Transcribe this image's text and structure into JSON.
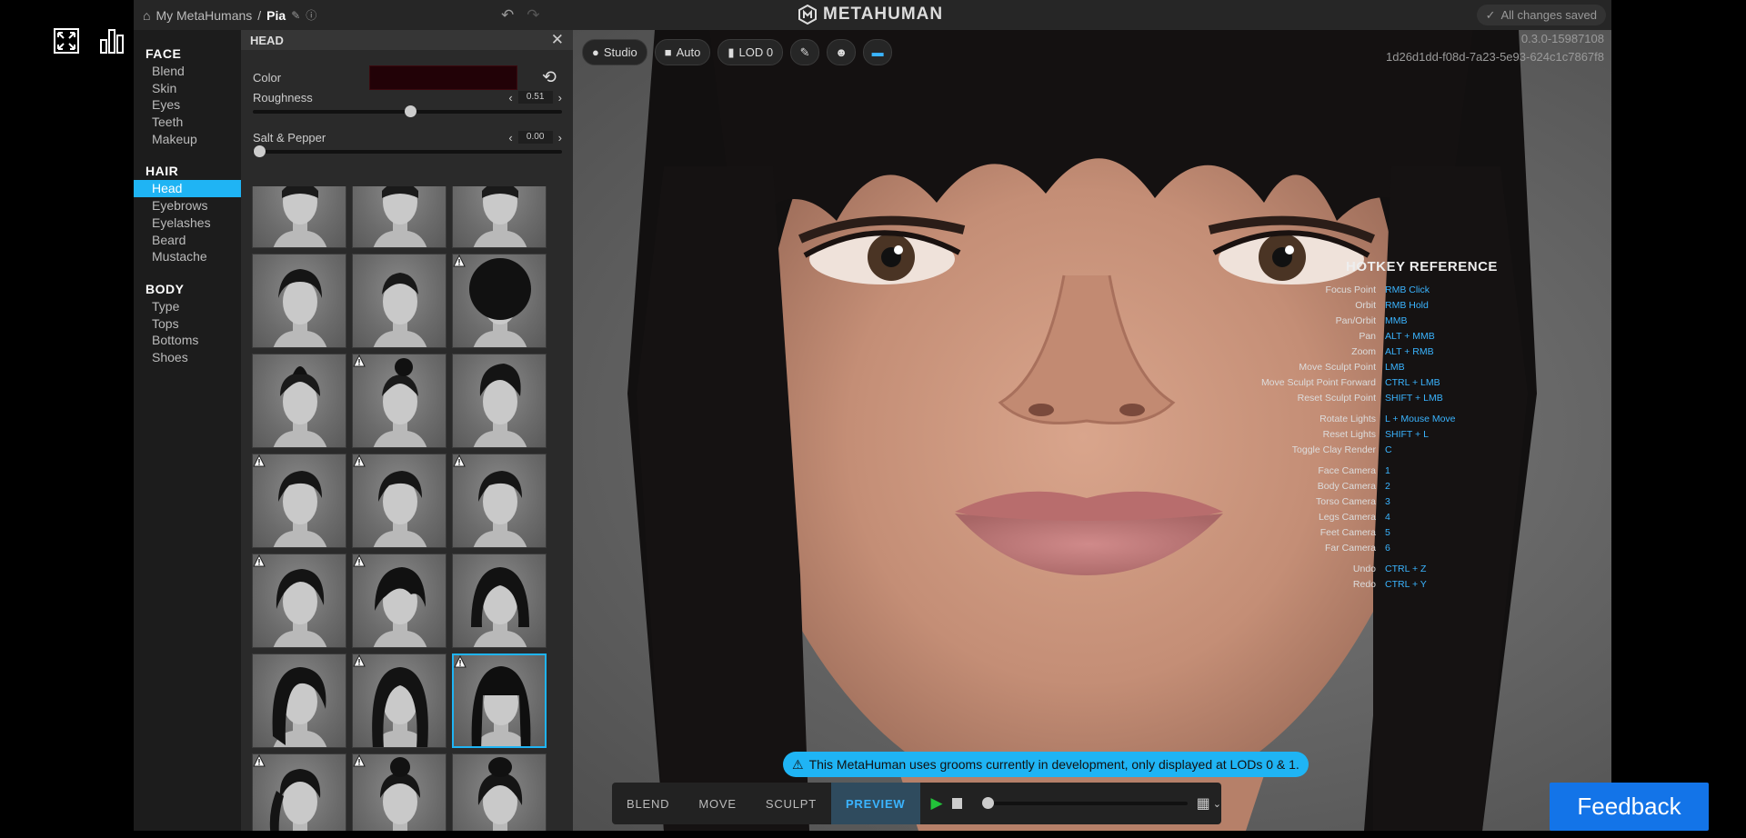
{
  "breadcrumb": {
    "root": "My MetaHumans",
    "separator": "/",
    "name": "Pia"
  },
  "logo_text": "METAHUMAN",
  "save_status": "All changes saved",
  "nav": {
    "sections": [
      {
        "title": "FACE",
        "items": [
          "Blend",
          "Skin",
          "Eyes",
          "Teeth",
          "Makeup"
        ]
      },
      {
        "title": "HAIR",
        "items": [
          "Head",
          "Eyebrows",
          "Eyelashes",
          "Beard",
          "Mustache"
        ]
      },
      {
        "title": "BODY",
        "items": [
          "Type",
          "Tops",
          "Bottoms",
          "Shoes"
        ]
      }
    ],
    "active": "Head"
  },
  "panel": {
    "title": "HEAD",
    "color_label": "Color",
    "color_value": "#220207",
    "roughness": {
      "label": "Roughness",
      "value": "0.51",
      "fraction": 0.51
    },
    "salt_pepper": {
      "label": "Salt & Pepper",
      "value": "0.00",
      "fraction": 0.0
    }
  },
  "hair_tiles": [
    {
      "style": "cropped",
      "warn": false
    },
    {
      "style": "cropped",
      "warn": false
    },
    {
      "style": "cropped",
      "warn": true
    },
    {
      "style": "curly-short",
      "warn": false
    },
    {
      "style": "buzz",
      "warn": false
    },
    {
      "style": "afro",
      "warn": true
    },
    {
      "style": "mohawk",
      "warn": false
    },
    {
      "style": "topknot",
      "warn": true
    },
    {
      "style": "pomp",
      "warn": false
    },
    {
      "style": "side-short",
      "warn": true
    },
    {
      "style": "side-short",
      "warn": true
    },
    {
      "style": "side-short",
      "warn": true
    },
    {
      "style": "wavy",
      "warn": true
    },
    {
      "style": "fringe-short",
      "warn": true
    },
    {
      "style": "bob",
      "warn": false
    },
    {
      "style": "long-side",
      "warn": false
    },
    {
      "style": "long-wavy",
      "warn": true
    },
    {
      "style": "long-bangs",
      "warn": true
    },
    {
      "style": "ponytail",
      "warn": true
    },
    {
      "style": "bun",
      "warn": true
    },
    {
      "style": "high-bun",
      "warn": false
    }
  ],
  "selected_tile": 17,
  "viewport": {
    "buttons": {
      "studio": "Studio",
      "auto": "Auto",
      "lod": "LOD 0"
    },
    "build_version": "0.3.0-15987108",
    "build_hash": "1d26d1dd-f08d-7a23-5e93-624c1c7867f8"
  },
  "hotkeys": {
    "title": "HOTKEY REFERENCE",
    "rows": [
      {
        "action": "Focus Point",
        "key": "RMB Click"
      },
      {
        "action": "Orbit",
        "key": "RMB Hold"
      },
      {
        "action": "Pan/Orbit",
        "key": "MMB"
      },
      {
        "action": "Pan",
        "key": "ALT + MMB"
      },
      {
        "action": "Zoom",
        "key": "ALT + RMB"
      },
      {
        "action": "Move Sculpt Point",
        "key": "LMB"
      },
      {
        "action": "Move Sculpt Point Forward",
        "key": "CTRL + LMB"
      },
      {
        "action": "Reset Sculpt Point",
        "key": "SHIFT + LMB"
      },
      {
        "action": "Rotate Lights",
        "key": "L + Mouse Move"
      },
      {
        "action": "Reset Lights",
        "key": "SHIFT + L"
      },
      {
        "action": "Toggle Clay Render",
        "key": "C"
      },
      {
        "action": "Face Camera",
        "key": "1"
      },
      {
        "action": "Body Camera",
        "key": "2"
      },
      {
        "action": "Torso Camera",
        "key": "3"
      },
      {
        "action": "Legs Camera",
        "key": "4"
      },
      {
        "action": "Feet Camera",
        "key": "5"
      },
      {
        "action": "Far Camera",
        "key": "6"
      },
      {
        "action": "Undo",
        "key": "CTRL + Z"
      },
      {
        "action": "Redo",
        "key": "CTRL + Y"
      }
    ]
  },
  "notice": "This MetaHuman uses grooms currently in development, only displayed at LODs 0 & 1.",
  "modes": [
    "BLEND",
    "MOVE",
    "SCULPT",
    "PREVIEW"
  ],
  "active_mode": "PREVIEW",
  "timeline_progress": 0.0,
  "feedback_label": "Feedback",
  "colors": {
    "accent": "#1fb4f4",
    "hotkey": "#3ab4ff",
    "feedback": "#1374e8",
    "play": "#22c33a"
  }
}
